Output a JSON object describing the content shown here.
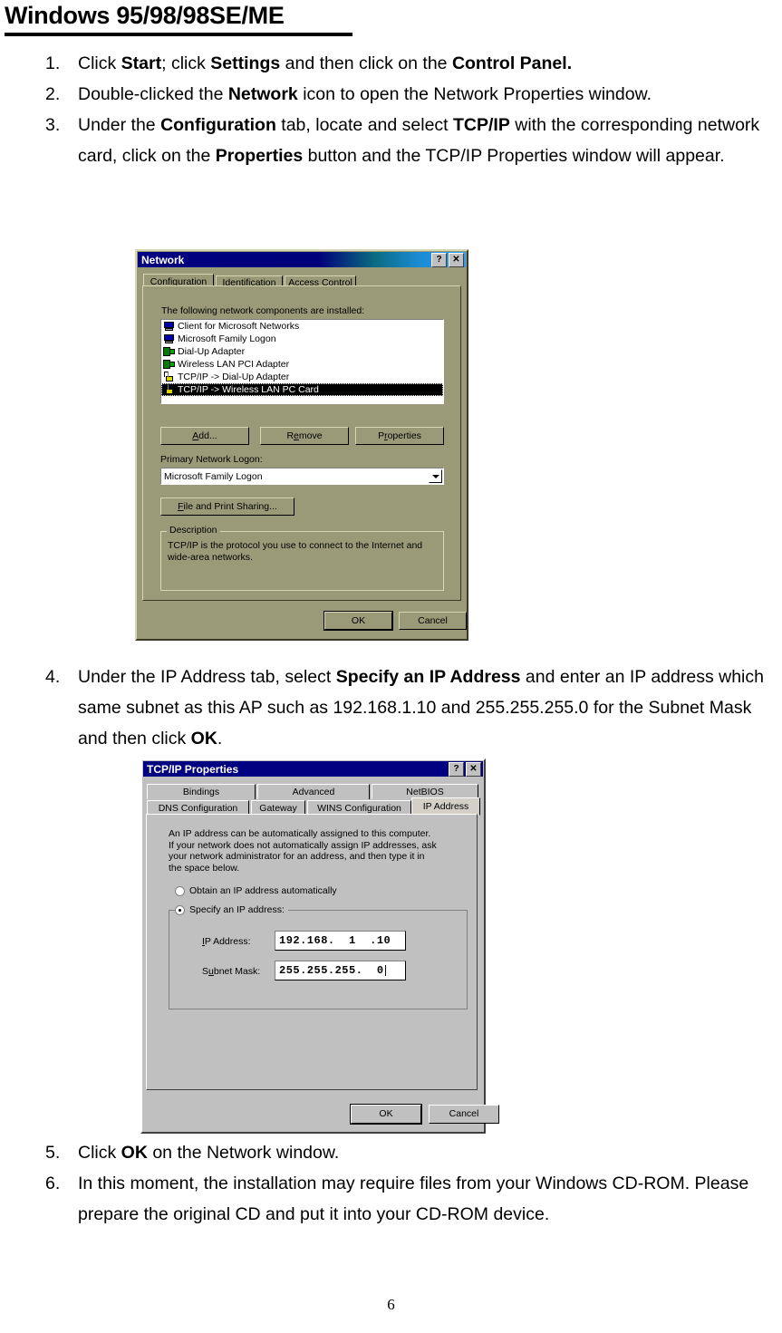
{
  "document": {
    "heading": "Windows 95/98/98SE/ME",
    "page_number": "6"
  },
  "steps_top": [
    {
      "num": "1.",
      "html": "Click <b>Start</b>; click <b>Settings</b> and then click on the <b>Control Panel.</b>"
    },
    {
      "num": "2.",
      "html": "Double-clicked the <b>Network</b> icon to open the Network Properties window."
    },
    {
      "num": "3.",
      "html": "Under the <b>Configuration</b> tab, locate and select <b>TCP/IP</b> with the corresponding network card, click on the <b>Properties</b> button and the TCP/IP Properties window will appear."
    }
  ],
  "steps_mid": [
    {
      "num": "4.",
      "html": "Under the IP Address tab, select <b>Specify an IP Address</b> and enter an IP address which same subnet as this AP such as 192.168.1.10 and 255.255.255.0 for the Subnet Mask and then click <b>OK</b>."
    }
  ],
  "steps_bot": [
    {
      "num": "5.",
      "html": "Click <b>OK</b> on the Network window."
    },
    {
      "num": "6.",
      "html": "In this moment, the installation may require files from your Windows CD-ROM. Please prepare the original CD and put it into your CD-ROM device."
    }
  ],
  "network_dialog": {
    "title": "Network",
    "help_button": "?",
    "close_button": "✕",
    "tabs": [
      {
        "label": "Configuration",
        "active": true
      },
      {
        "label": "Identification",
        "active": false
      },
      {
        "label": "Access Control",
        "active": false
      }
    ],
    "list_label": "The following network components are installed:",
    "components": [
      {
        "name": "Client for Microsoft Networks",
        "icon": "computer-icon",
        "selected": false
      },
      {
        "name": "Microsoft Family Logon",
        "icon": "computer-icon",
        "selected": false
      },
      {
        "name": "Dial-Up Adapter",
        "icon": "network-adapter-icon",
        "selected": false
      },
      {
        "name": "Wireless LAN PCI Adapter",
        "icon": "network-adapter-icon",
        "selected": false
      },
      {
        "name": "TCP/IP -> Dial-Up Adapter",
        "icon": "protocol-icon",
        "selected": false
      },
      {
        "name": "TCP/IP -> Wireless LAN  PC Card",
        "icon": "protocol-icon",
        "selected": true
      }
    ],
    "buttons": {
      "add": "Add...",
      "remove": "Remove",
      "properties": "Properties"
    },
    "primary_logon_label": "Primary Network Logon:",
    "primary_logon_value": "Microsoft Family Logon",
    "file_print_sharing": "File and Print Sharing...",
    "description_title": "Description",
    "description_text": "TCP/IP is the protocol you use to connect to the Internet and\nwide-area networks.",
    "ok": "OK",
    "cancel": "Cancel"
  },
  "tcpip_dialog": {
    "title": "TCP/IP Properties",
    "help_button": "?",
    "close_button": "✕",
    "tabs_row1": [
      {
        "label": "Bindings",
        "active": false
      },
      {
        "label": "Advanced",
        "active": false
      },
      {
        "label": "NetBIOS",
        "active": false
      }
    ],
    "tabs_row2": [
      {
        "label": "DNS Configuration",
        "active": false
      },
      {
        "label": "Gateway",
        "active": false
      },
      {
        "label": "WINS Configuration",
        "active": false
      },
      {
        "label": "IP Address",
        "active": true
      }
    ],
    "description": "An IP address can be automatically assigned to this computer.\nIf your network does not automatically assign IP addresses, ask\nyour network administrator for an address, and then type it in\nthe space below.",
    "radio_obtain": "Obtain an IP address automatically",
    "radio_specify": "Specify an IP address:",
    "radio_selected": "specify",
    "ip_address_label": "IP Address:",
    "ip_address_value": "192.168.  1  .10",
    "subnet_mask_label": "Subnet Mask:",
    "subnet_mask_value": "255.255.255.  0",
    "ok": "OK",
    "cancel": "Cancel"
  },
  "colors": {
    "network_face": "#9a9a78",
    "tcpip_face": "#c0c0c0",
    "titlebar_navy": "#000080",
    "selection": "#000000"
  }
}
